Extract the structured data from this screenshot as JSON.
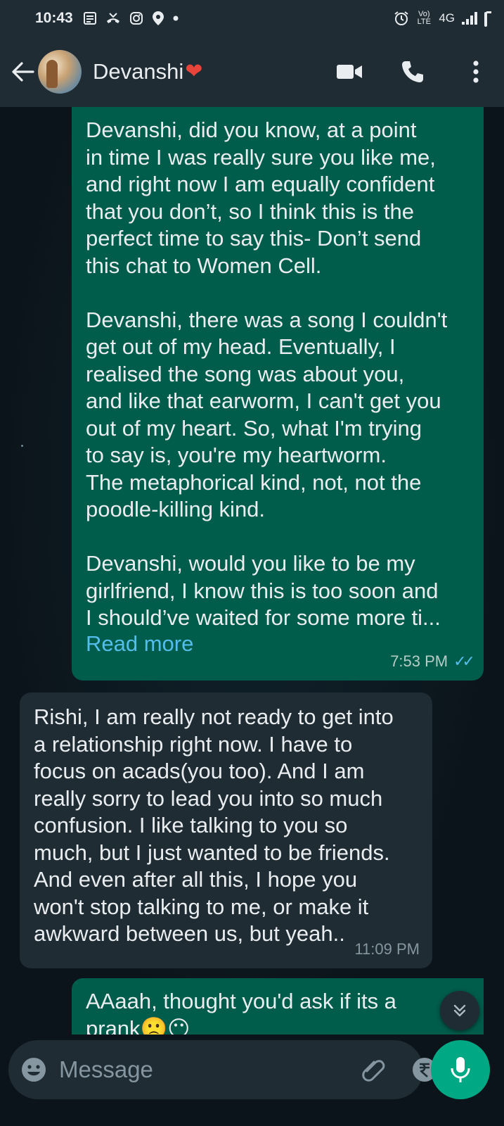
{
  "status_bar": {
    "time": "10:43",
    "network": "4G",
    "volte": "Vo) LTE",
    "left_icons": [
      "news-icon",
      "missed-call-icon",
      "instagram-icon",
      "location-icon",
      "dot-icon"
    ],
    "right_icons": [
      "alarm-icon",
      "volte-icon",
      "signal-icon",
      "battery-icon"
    ]
  },
  "header": {
    "contact_name": "Devanshi",
    "name_emoji": "❤",
    "icons": [
      "back-arrow-icon",
      "video-call-icon",
      "voice-call-icon",
      "more-options-icon"
    ]
  },
  "messages": [
    {
      "direction": "outgoing",
      "paragraphs": [
        "Devanshi, did you know, at a point\nin time I was really sure you like me,\nand right now I am equally confident\nthat you don’t, so I think this is the\nperfect time to say this- Don’t send\nthis chat to Women Cell.",
        "Devanshi, there was a song I couldn't\nget out of my head. Eventually, I\nrealised the song was about you,\nand like that earworm, I can't get you\nout of my heart. So, what I'm trying\nto say is, you're my heartworm.\nThe metaphorical kind, not, not the\npoodle-killing kind.",
        "Devanshi, would you like to be my\ngirlfriend, I know this is too soon and\nI should’ve waited for some more ti..."
      ],
      "read_more": "Read more",
      "time": "7:53 PM",
      "status": "read"
    },
    {
      "direction": "incoming",
      "text": "Rishi, I am really not ready to get into\na relationship right now. I have to\nfocus on acads(you too). And I am\nreally sorry to lead you into so much\nconfusion. I like talking to you so\nmuch, but I just wanted to be friends.\nAnd even after all this, I hope you\nwon't stop talking to me, or make it\nawkward between us, but yeah..",
      "time": "11:09 PM"
    },
    {
      "direction": "outgoing",
      "text": "AAaah, thought you'd ask if its a\nprank😐😶",
      "emojis": "🙂😐"
    }
  ],
  "input": {
    "placeholder": "Message"
  },
  "colors": {
    "outgoing_bubble": "#005c4b",
    "incoming_bubble": "#1f2c34",
    "accent": "#00a884",
    "link": "#53bdeb",
    "background": "#0b141a"
  }
}
